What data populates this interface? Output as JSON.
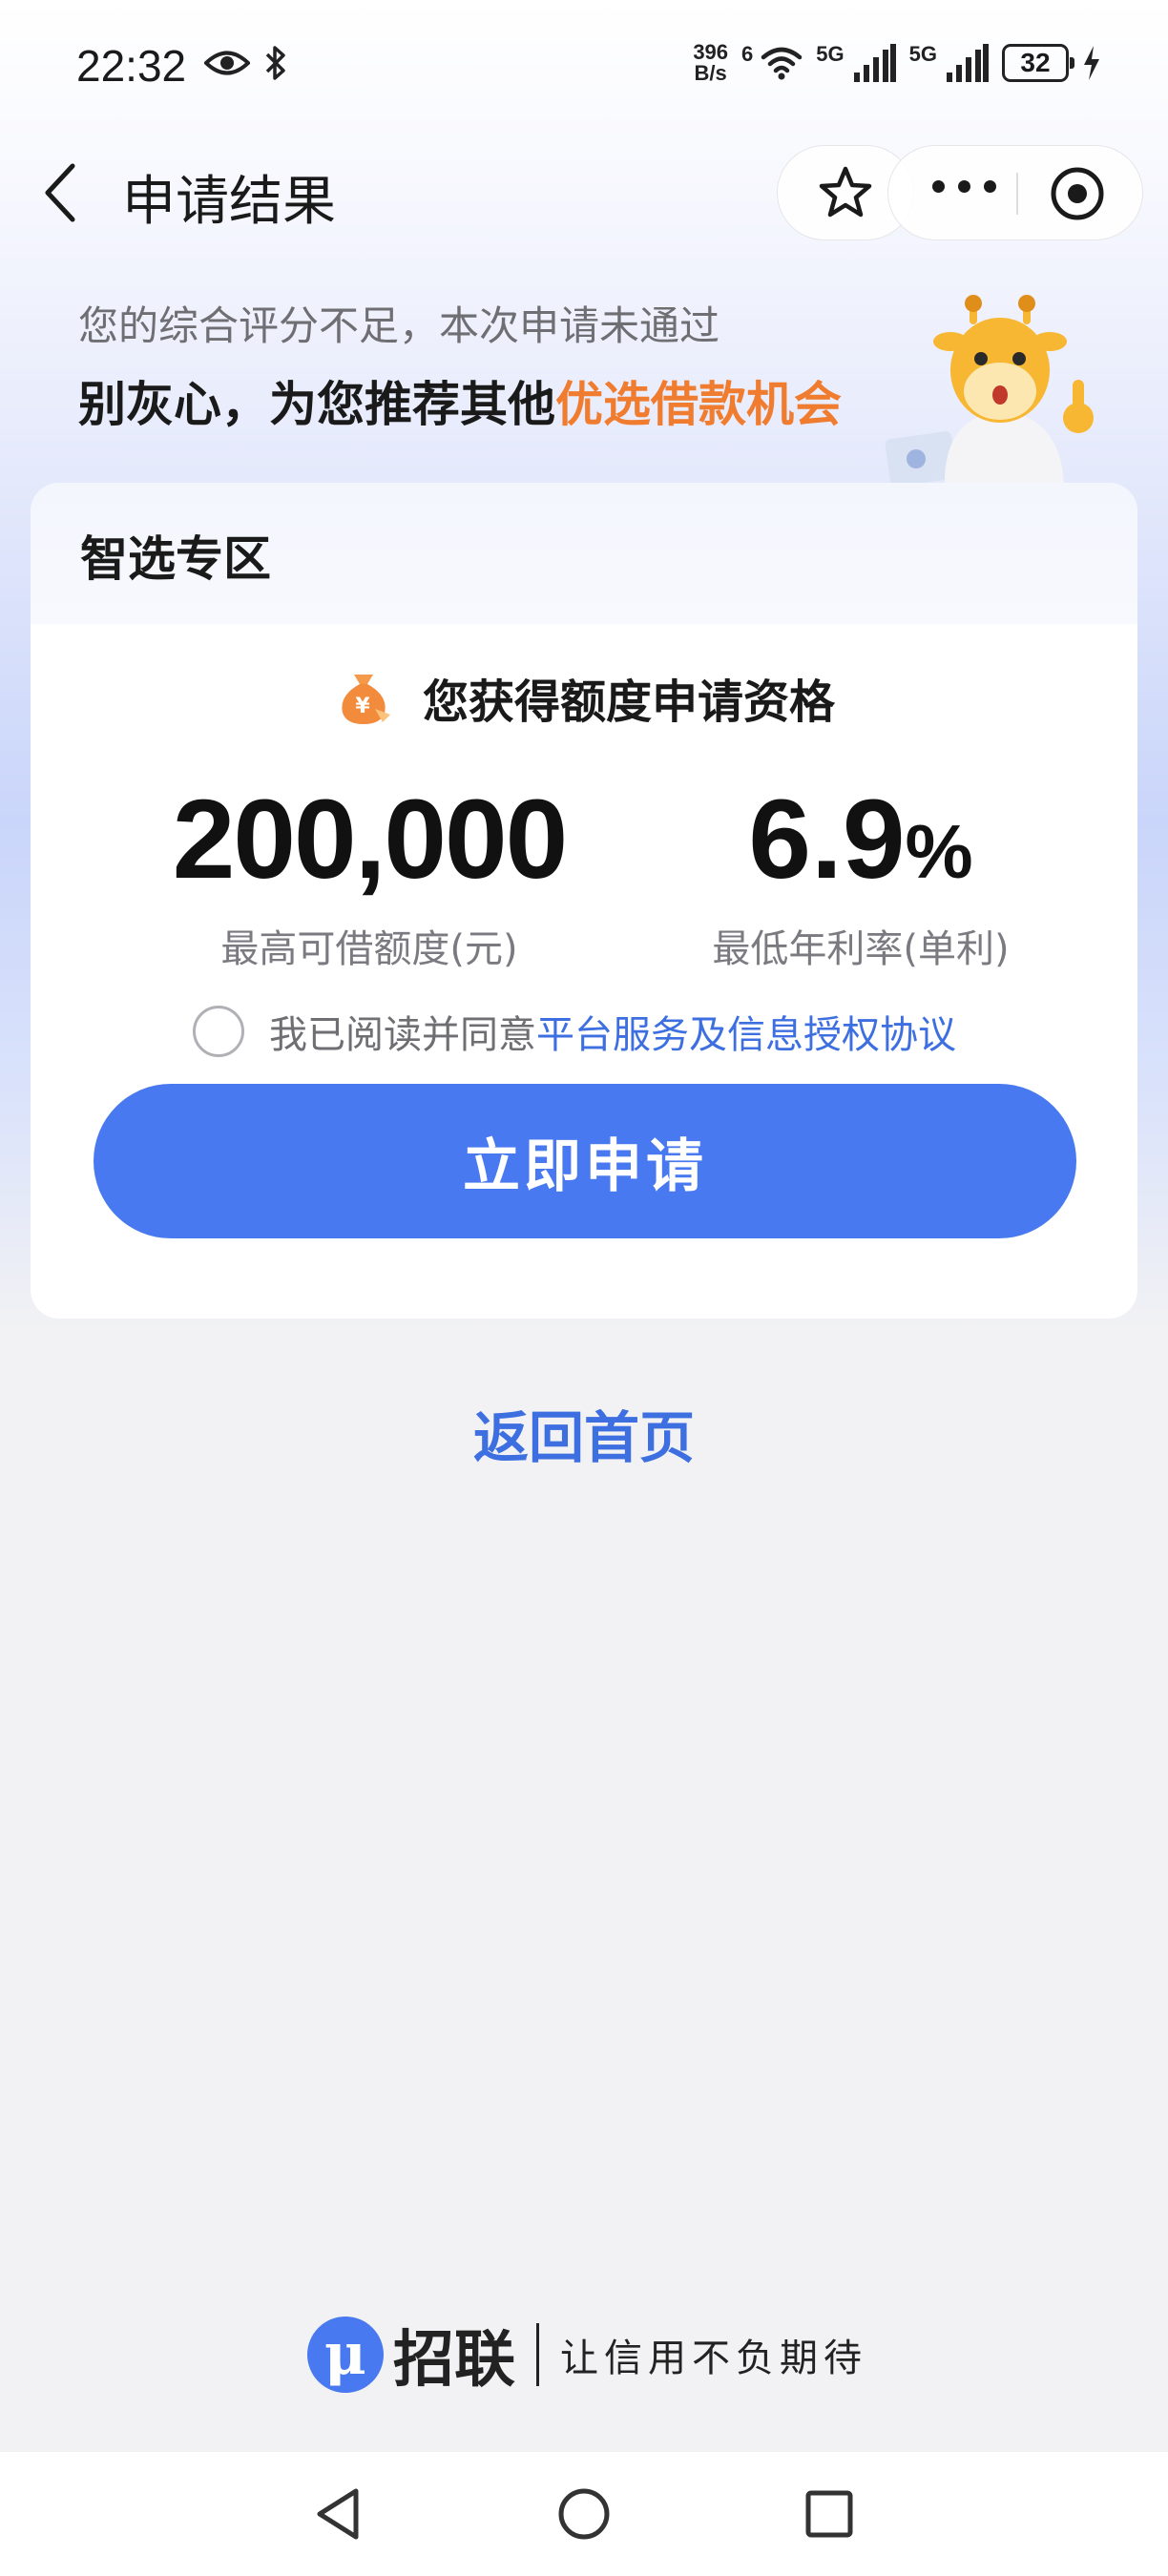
{
  "status_bar": {
    "time": "22:32",
    "net_speed_value": "396",
    "net_speed_unit": "B/s",
    "wifi_gen": "6",
    "sim1_label": "5G",
    "sim2_label": "5G",
    "battery": "32"
  },
  "nav": {
    "title": "申请结果"
  },
  "header": {
    "fail_message": "您的综合评分不足，本次申请未通过",
    "encourage_prefix": "别灰心，为您推荐其他",
    "encourage_highlight": "优选借款机会"
  },
  "card": {
    "title": "智选专区",
    "qualification": "您获得额度申请资格",
    "amount_value": "200,000",
    "amount_label": "最高可借额度(元)",
    "rate_value": "6.9",
    "rate_unit": "%",
    "rate_label": "最低年利率(单利)",
    "agree_text": "我已阅读并同意",
    "agree_link": "平台服务及信息授权协议",
    "apply_button": "立即申请"
  },
  "home_link": "返回首页",
  "footer": {
    "logo_glyph": "μ",
    "brand_name": "招联",
    "slogan": "让信用不负期待"
  },
  "colors": {
    "accent_blue": "#4879f0",
    "highlight_orange": "#f07c30",
    "link_blue": "#3d6fe0"
  }
}
